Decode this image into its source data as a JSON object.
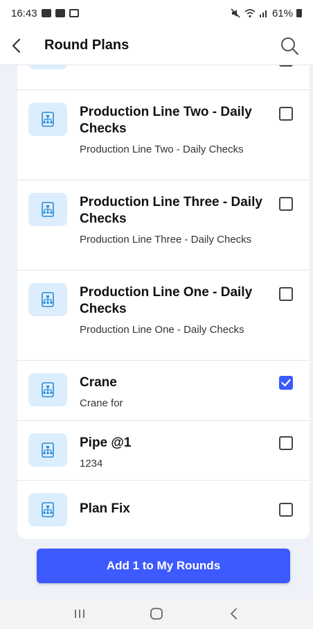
{
  "status_bar": {
    "time": "16:43",
    "battery": "61%"
  },
  "header": {
    "title": "Round Plans"
  },
  "rows": [
    {
      "title": "",
      "subtitle": "",
      "checked": false
    },
    {
      "title": "Production Line Two - Daily Checks",
      "subtitle": "Production Line Two - Daily Checks",
      "checked": false
    },
    {
      "title": "Production Line Three - Daily Checks",
      "subtitle": "Production Line Three - Daily Checks",
      "checked": false
    },
    {
      "title": "Production Line One - Daily Checks",
      "subtitle": "Production Line One - Daily Checks",
      "checked": false
    },
    {
      "title": "Crane",
      "subtitle": "Crane for",
      "checked": true
    },
    {
      "title": "Pipe @1",
      "subtitle": "1234",
      "checked": false
    },
    {
      "title": "Plan Fix",
      "subtitle": "",
      "checked": false
    }
  ],
  "add_button": {
    "label": "Add 1 to My Rounds"
  },
  "colors": {
    "accent": "#3d5afe",
    "thumb_bg": "#dceefd",
    "thumb_icon": "#2a8bd8",
    "content_bg": "#eef1f7"
  },
  "icons": {
    "back": "chevron-left-icon",
    "search": "search-icon",
    "plan": "plan-document-icon",
    "nav_recents": "recents-icon",
    "nav_home": "home-icon",
    "nav_back": "back-icon"
  }
}
